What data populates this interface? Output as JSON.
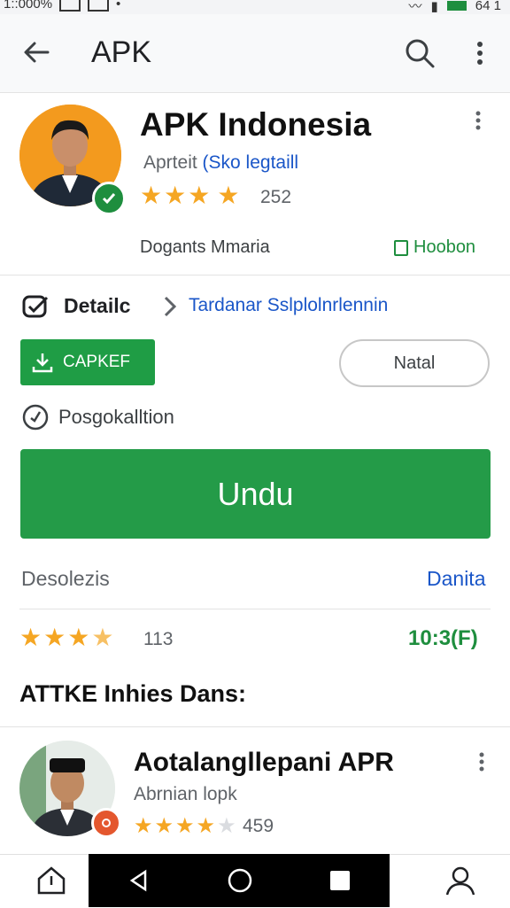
{
  "status_bar": {
    "time": "1::000%",
    "left_icons": [
      "ht",
      "26"
    ],
    "right_text": "64 1"
  },
  "appbar": {
    "title": "APK"
  },
  "app": {
    "name": "APK Indonesia",
    "developer": "Aprteit",
    "developer_tag": "(Sko legtaill",
    "rating_stars": 3.5,
    "rating_count": "252",
    "meta_left": "Dogants Mmaria",
    "meta_right": "Hoobon"
  },
  "details": {
    "label": "Detailc",
    "link": "Tardanar Sslplolnrlennin"
  },
  "buttons": {
    "install_label": "CAPKEF",
    "outline_label": "Natal",
    "main_label": "Undu"
  },
  "processing": {
    "label": "Posgokalltion"
  },
  "description": {
    "label": "Desolezis",
    "link": "Danita"
  },
  "ratings": {
    "stars": 3.5,
    "count": "113",
    "ratio": "10:3(F)"
  },
  "section": {
    "title": "ATTKE Inhies Dans:"
  },
  "related": {
    "name": "Aotalangllepani APR",
    "developer": "Abrnian lopk",
    "stars": 3.5,
    "count": "459"
  },
  "colors": {
    "accent_green": "#249b48",
    "link_blue": "#1a56c8",
    "star": "#f5a623"
  },
  "bottom_tabs": [
    "home-icon",
    "profile-icon"
  ]
}
